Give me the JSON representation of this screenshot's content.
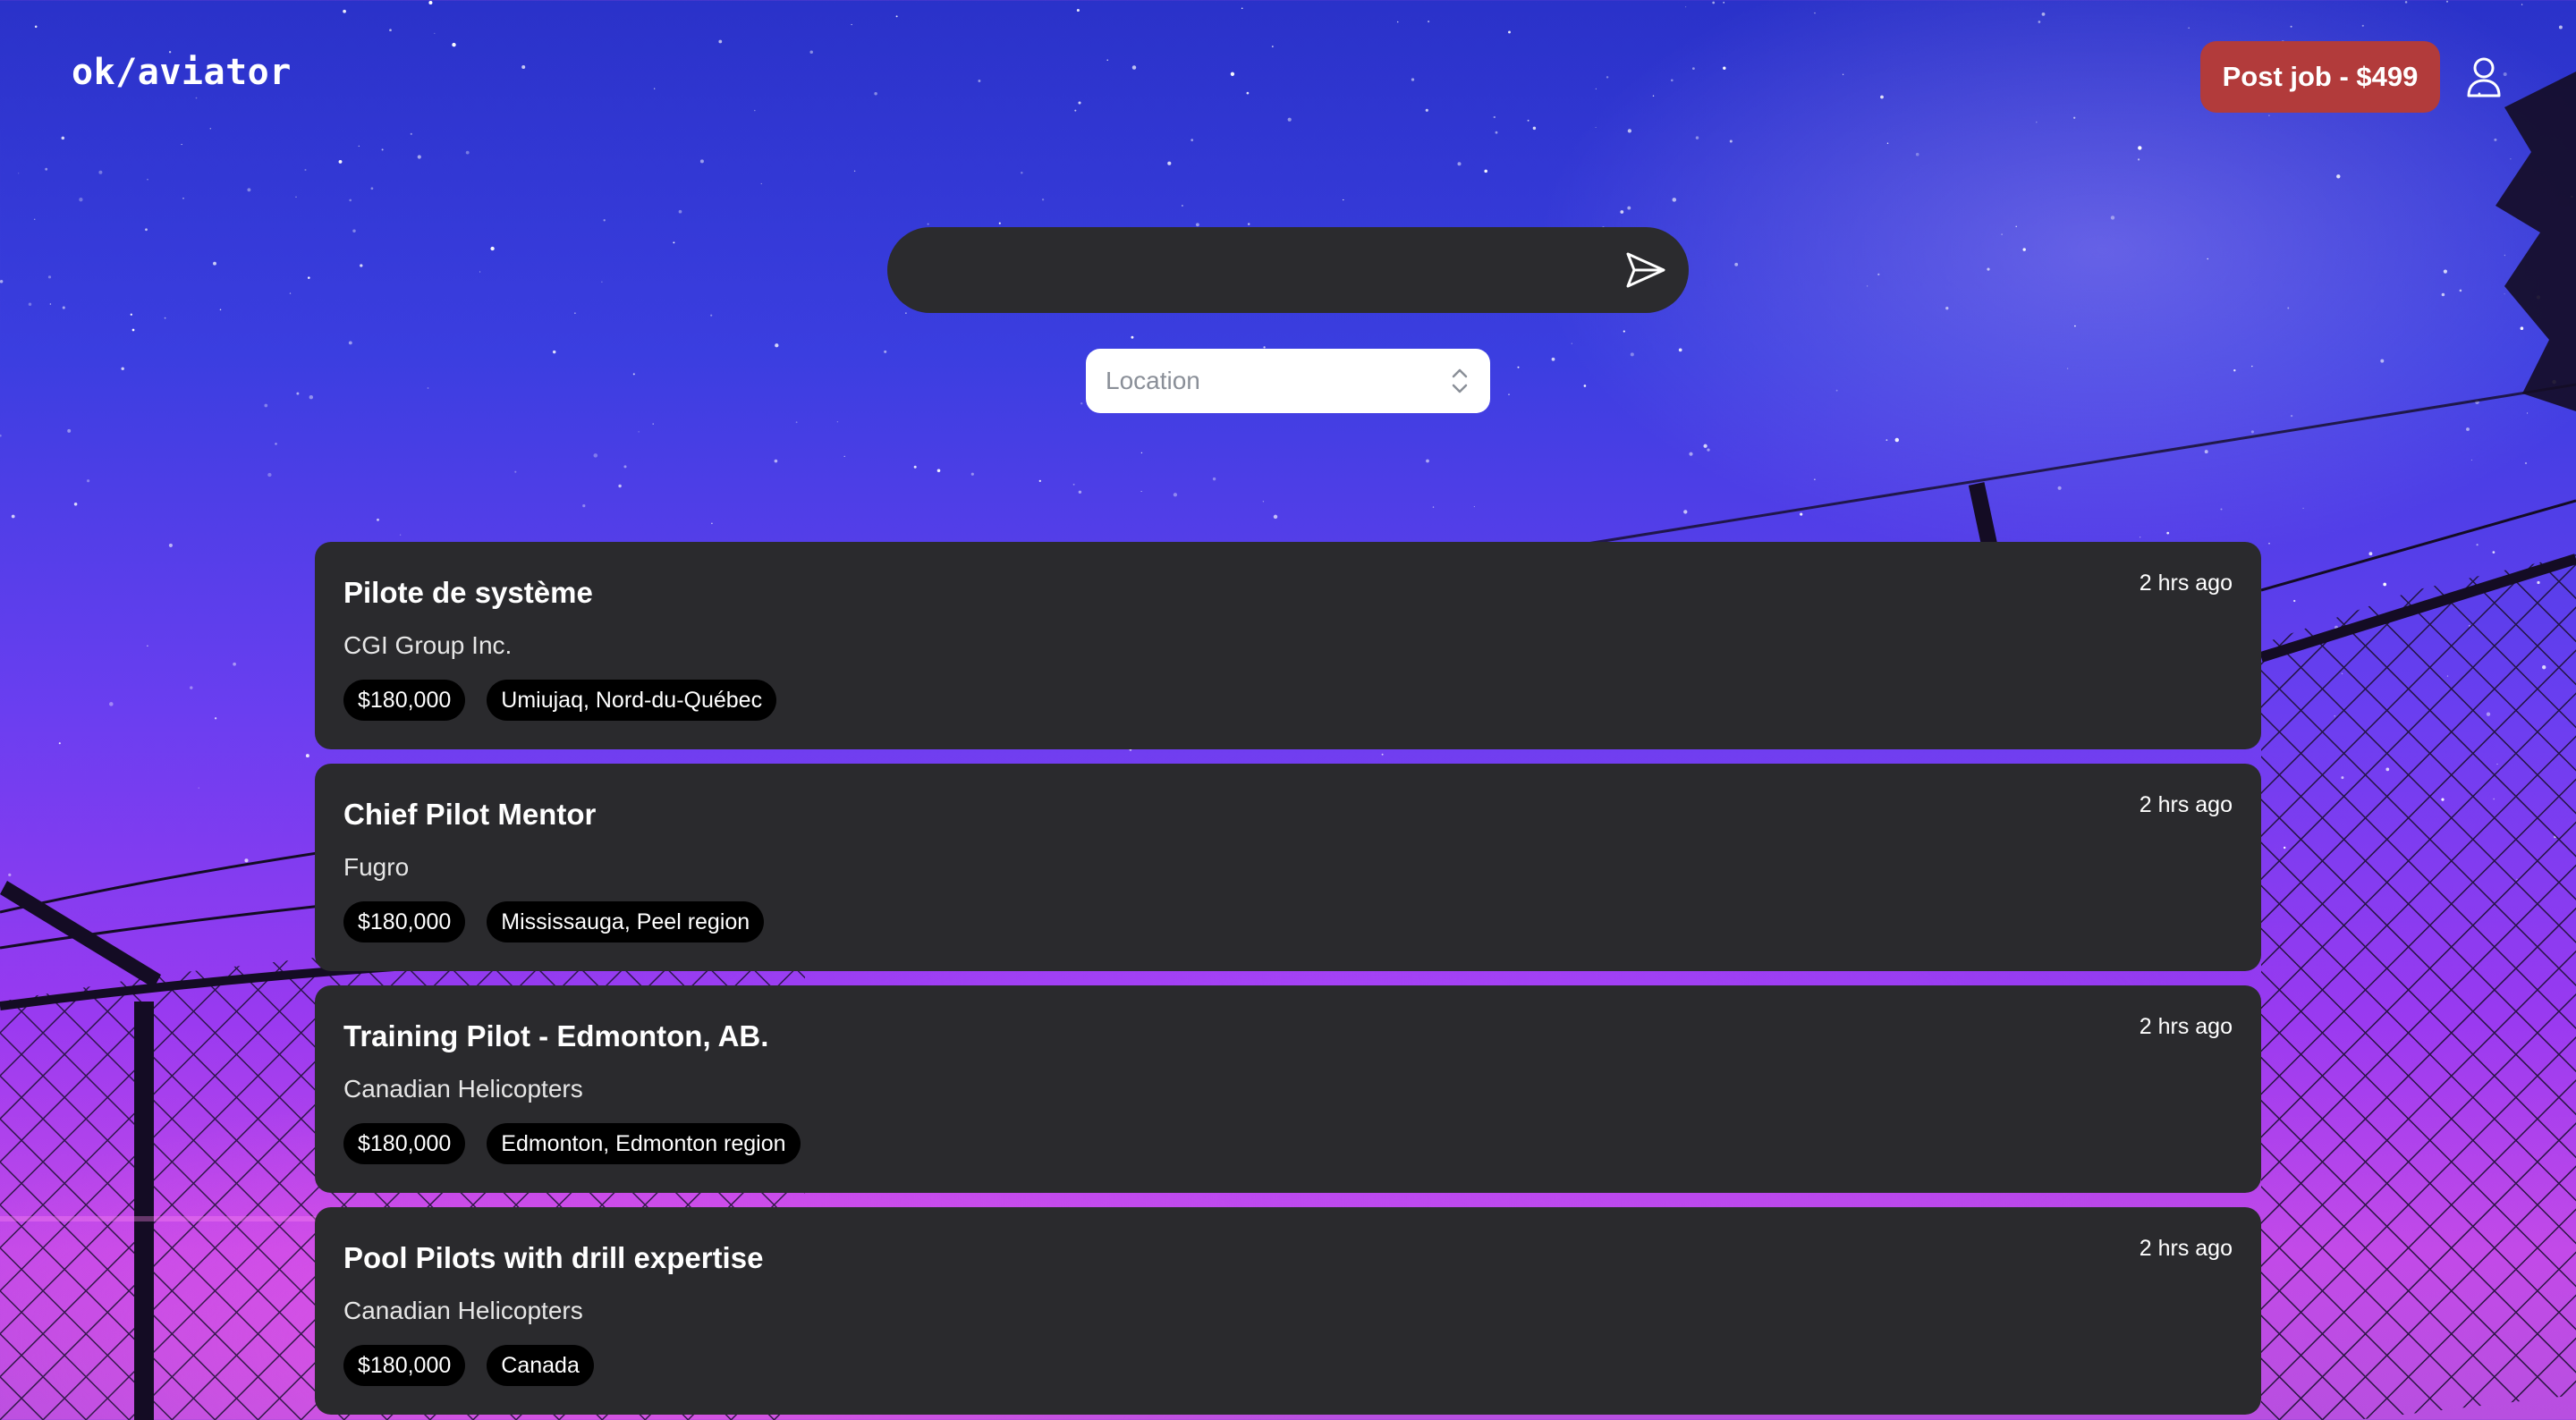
{
  "header": {
    "logo": "ok/aviator",
    "post_job_label": "Post job - $499",
    "user_icon": "user-icon"
  },
  "search": {
    "value": "",
    "send_icon": "send-icon",
    "location_placeholder": "Location"
  },
  "jobs": [
    {
      "title": "Pilote de système",
      "company": "CGI Group Inc.",
      "posted": "2 hrs ago",
      "salary": "$180,000",
      "location": "Umiujaq, Nord-du-Québec"
    },
    {
      "title": "Chief Pilot Mentor",
      "company": "Fugro",
      "posted": "2 hrs ago",
      "salary": "$180,000",
      "location": "Mississauga, Peel region"
    },
    {
      "title": "Training Pilot - Edmonton, AB.",
      "company": "Canadian Helicopters",
      "posted": "2 hrs ago",
      "salary": "$180,000",
      "location": "Edmonton, Edmonton region"
    },
    {
      "title": "Pool Pilots with drill expertise",
      "company": "Canadian Helicopters",
      "posted": "2 hrs ago",
      "salary": "$180,000",
      "location": "Canada"
    }
  ],
  "colors": {
    "post_job_bg": "#b23b3b",
    "card_bg": "#2a2a2d",
    "tag_bg": "#000000"
  }
}
